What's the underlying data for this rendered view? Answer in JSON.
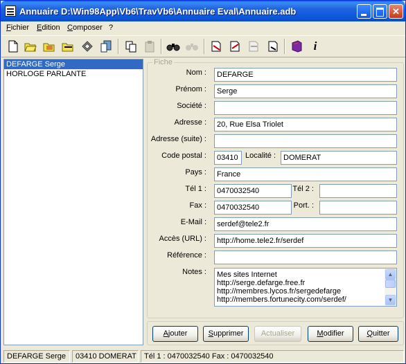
{
  "window": {
    "title": "Annuaire D:\\Win98App\\Vb6\\TravVb6\\Annuaire Eval\\Annuaire.adb"
  },
  "menu": {
    "fichier_first": "F",
    "fichier_rest": "ichier",
    "edition_first": "E",
    "edition_rest": "dition",
    "composer_first": "C",
    "composer_rest": "omposer",
    "help": "?"
  },
  "toolbar": {
    "icons": [
      "new-icon",
      "open-icon",
      "save-icon",
      "save-as-icon",
      "print-setup-icon",
      "export-icon",
      "copy-icon",
      "paste-icon",
      "find-icon",
      "find-next-icon",
      "letter-icon",
      "letter-fill-icon",
      "merge-icon",
      "envelope-icon",
      "book-icon",
      "info-icon"
    ]
  },
  "contacts": [
    {
      "name": "DEFARGE Serge",
      "selected": true
    },
    {
      "name": "HORLOGE PARLANTE",
      "selected": false
    }
  ],
  "form": {
    "group_title": "Fiche",
    "labels": {
      "nom": "Nom :",
      "prenom": "Prénom :",
      "societe": "Société :",
      "adresse": "Adresse :",
      "adresse_suite": "Adresse (suite) :",
      "code_postal": "Code postal :",
      "localite": "Localité :",
      "pays": "Pays :",
      "tel1": "Tél 1 :",
      "tel2": "Tél 2 :",
      "fax": "Fax :",
      "port": "Port. :",
      "email": "E-Mail :",
      "acces": "Accès (URL) :",
      "reference": "Référence :",
      "notes": "Notes :"
    },
    "values": {
      "nom": "DEFARGE",
      "prenom": "Serge",
      "societe": "",
      "adresse": "20, Rue Elsa Triolet",
      "adresse_suite": "",
      "code_postal": "03410",
      "localite": "DOMERAT",
      "pays": "France",
      "tel1": "0470032540",
      "tel2": "",
      "fax": "0470032540",
      "port": "",
      "email": "serdef@tele2.fr",
      "acces": "http://home.tele2.fr/serdef",
      "reference": ""
    },
    "notes_lines": [
      "Mes sites Internet",
      "http://serge.defarge.free.fr",
      "http://membres.lycos.fr/sergedefarge",
      "http://members.fortunecity.com/serdef/"
    ]
  },
  "buttons": {
    "ajouter_first": "A",
    "ajouter_rest": "jouter",
    "supprimer_first": "S",
    "supprimer_rest": "upprimer",
    "actualiser": "Actualiser",
    "modifier_first": "M",
    "modifier_rest": "odifier",
    "quitter_first": "Q",
    "quitter_rest": "uitter"
  },
  "status": {
    "name": "DEFARGE Serge",
    "city": "03410 DOMERAT",
    "phones": "Tél 1 : 0470032540  Fax : 0470032540"
  },
  "colors": {
    "selection": "#316AC5",
    "titlebar": "#0B55D8",
    "window_bg": "#ECE9D8"
  }
}
